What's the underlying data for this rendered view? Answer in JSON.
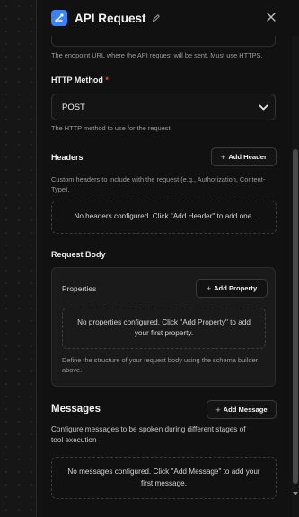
{
  "header": {
    "title": "API Request",
    "icon": "webhook-icon",
    "accent_color": "#3b82f6"
  },
  "url_field": {
    "help": "The endpoint URL where the API request will be sent. Must use HTTPS."
  },
  "http_method": {
    "label": "HTTP Method",
    "required_mark": "*",
    "selected": "POST",
    "help": "The HTTP method to use for the request."
  },
  "headers": {
    "label": "Headers",
    "add_label": "Add Header",
    "help": "Custom headers to include with the request (e.g., Authorization, Content-Type).",
    "empty": "No headers configured. Click \"Add Header\" to add one."
  },
  "request_body": {
    "label": "Request Body",
    "properties_label": "Properties",
    "add_label": "Add Property",
    "empty": "No properties configured. Click \"Add Property\" to add your first property.",
    "help": "Define the structure of your request body using the schema builder above."
  },
  "messages": {
    "label": "Messages",
    "add_label": "Add Message",
    "help": "Configure messages to be spoken during different stages of tool execution",
    "empty": "No messages configured. Click \"Add Message\" to add your first message."
  }
}
